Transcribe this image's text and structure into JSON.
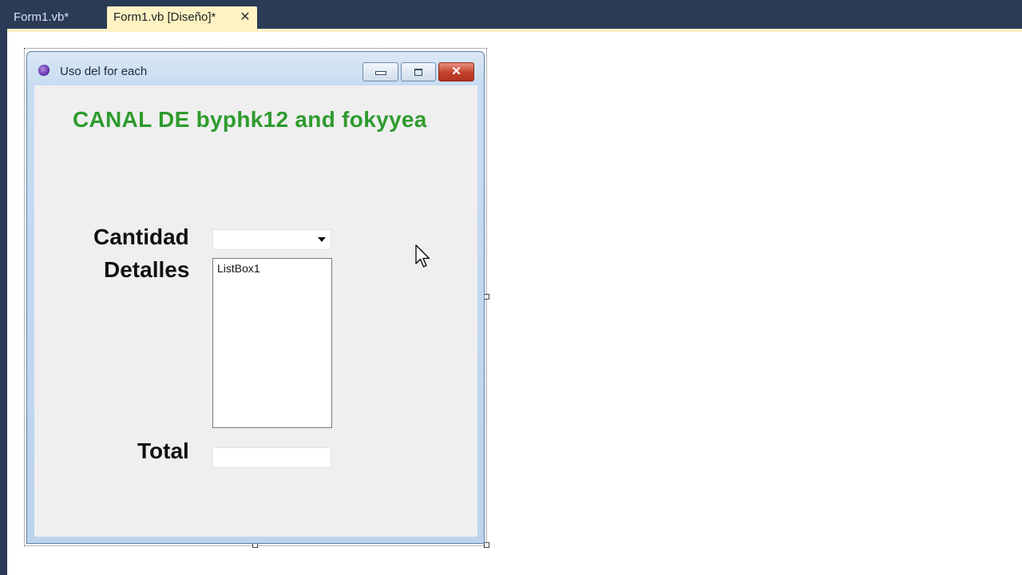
{
  "tabs": [
    {
      "label": "Form1.vb*",
      "active": false
    },
    {
      "label": "Form1.vb [Diseño]*",
      "active": true,
      "close_icon": "close-icon"
    }
  ],
  "form": {
    "title": "Uso del for each",
    "icon": "vb-form-icon",
    "caption_buttons": [
      "minimize-icon",
      "maximize-icon",
      "close-icon"
    ],
    "caption_close_glyph": "✕",
    "heading": "CANAL DE byphk12 and fokyyea",
    "heading_color": "#2e9b2e",
    "labels": {
      "cantidad": "Cantidad",
      "detalles": "Detalles",
      "total": "Total"
    },
    "combobox": {
      "value": ""
    },
    "listbox": {
      "items": [
        "ListBox1"
      ]
    },
    "textbox": {
      "value": ""
    }
  },
  "colors": {
    "ide_background": "#2b3a55",
    "active_tab": "#fff3c4",
    "form_client": "#efefef"
  }
}
